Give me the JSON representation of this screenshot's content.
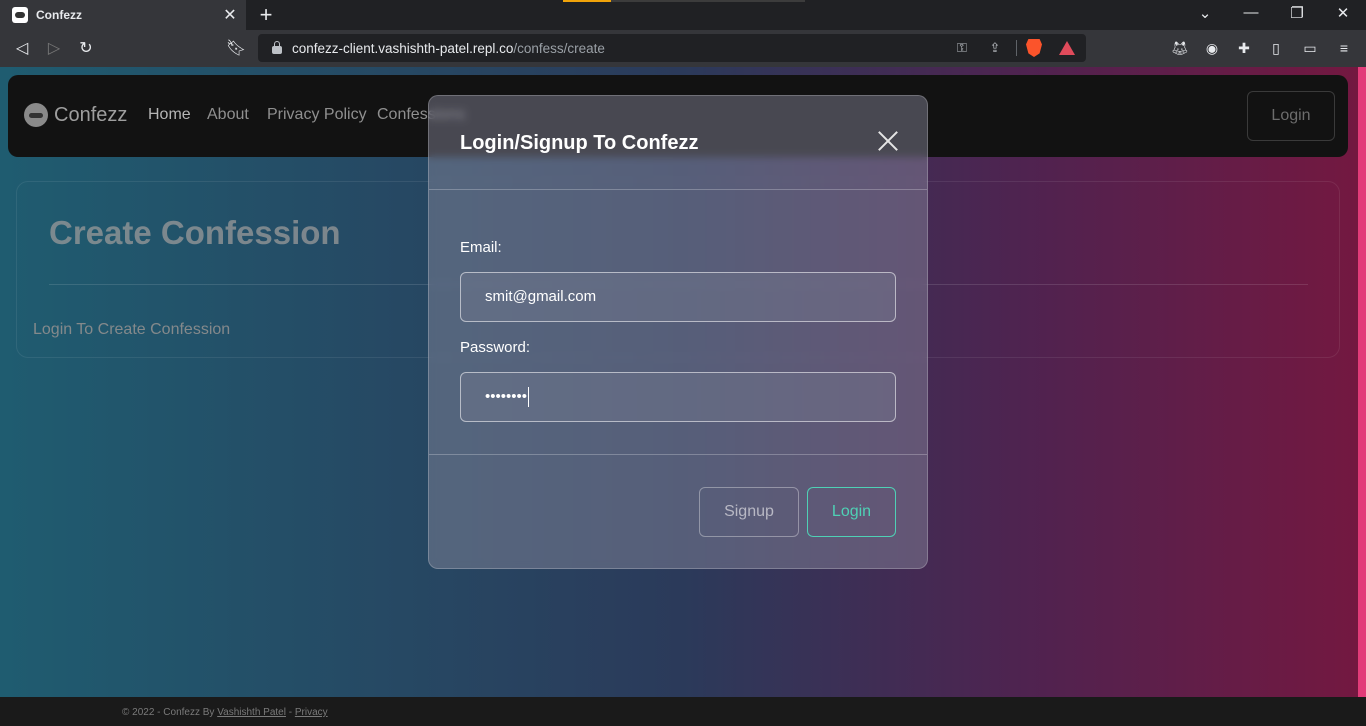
{
  "browser": {
    "tab_title": "Confezz",
    "url_host": "confezz-client.vashishth-patel.repl.co",
    "url_path": "/confess/create"
  },
  "navbar": {
    "brand": "Confezz",
    "links": [
      "Home",
      "About",
      "Privacy Policy",
      "Confessions"
    ],
    "login_label": "Login"
  },
  "card": {
    "title": "Create Confession",
    "text": "Login To Create Confession"
  },
  "footer": {
    "prefix": "© 2022 - Confezz By ",
    "author": "Vashishth Patel",
    "separator": " - ",
    "privacy": "Privacy"
  },
  "modal": {
    "title": "Login/Signup To Confezz",
    "email_label": "Email:",
    "email_value": "smit@gmail.com",
    "password_label": "Password:",
    "password_value": "••••••••",
    "signup_label": "Signup",
    "login_label": "Login"
  },
  "colors": {
    "accent": "#4fd1b5",
    "gradient_start": "#1f5c70",
    "gradient_end": "#741840"
  }
}
